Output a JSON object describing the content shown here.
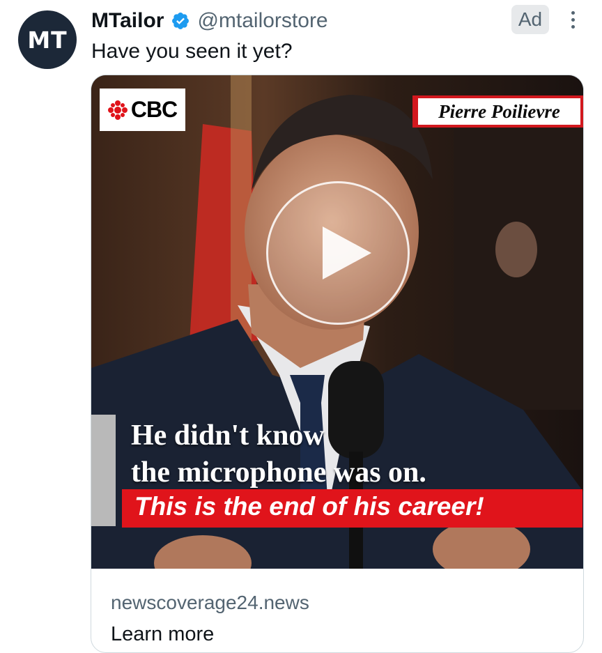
{
  "tweet": {
    "avatar_initials": "MT",
    "display_name": "MTailor",
    "verified_icon": "verified-badge-icon",
    "handle": "@mtailorstore",
    "ad_label": "Ad",
    "more_icon": "more-vertical-icon",
    "text": "Have you seen it yet?"
  },
  "card": {
    "media": {
      "logo_text": "CBC",
      "logo_icon": "cbc-gem-icon",
      "name_tag": "Pierre Poilievre",
      "caption_line1": "He didn't know",
      "caption_line2": "the microphone was on.",
      "caption_highlight": "This is the end of his career!",
      "play_icon": "play-icon"
    },
    "domain": "newscoverage24.news",
    "cta": "Learn more"
  },
  "colors": {
    "verified_blue": "#1d9bf0",
    "secondary_text": "#536471",
    "cbc_red": "#e0141b",
    "avatar_bg": "#1c2838"
  }
}
